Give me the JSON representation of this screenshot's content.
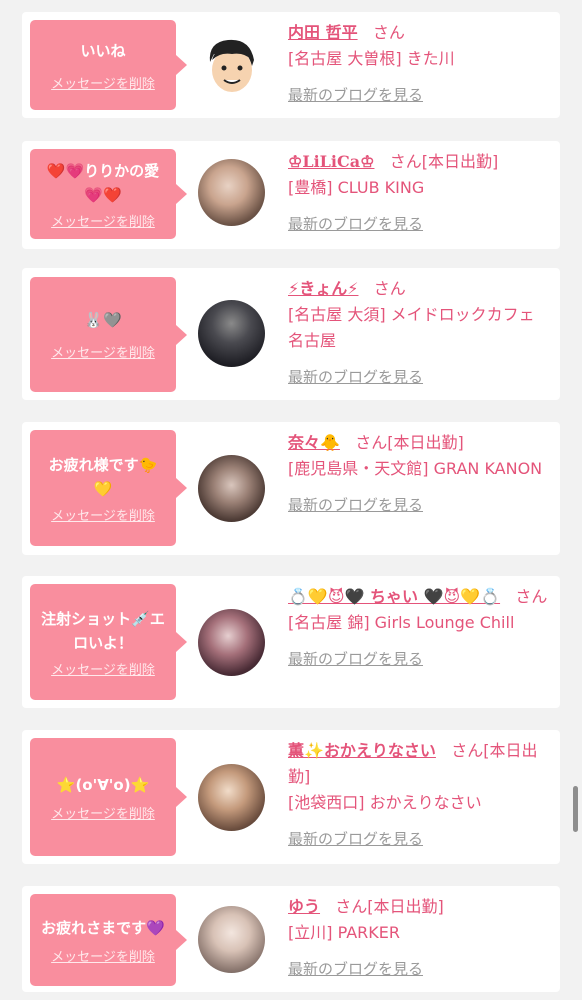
{
  "entries": [
    {
      "message": "いいね",
      "delete_label": "メッセージを削除",
      "name": "内田 哲平",
      "suffix": "さん",
      "shop": "[名古屋 大曽根] きた川",
      "blog_label": "最新のブログを見る",
      "avatar": "cartoon-face"
    },
    {
      "message": "❤️💗りりかの愛💗❤️",
      "delete_label": "メッセージを削除",
      "name": "♔LiLiCa♔",
      "suffix": "さん[本日出勤]",
      "shop": "[豊橋] CLUB KING",
      "blog_label": "最新のブログを見る",
      "avatar": "photo"
    },
    {
      "message": "🐰🩶",
      "delete_label": "メッセージを削除",
      "name": "⚡きょん⚡",
      "suffix": "さん",
      "shop": "[名古屋 大須] メイドロックカフェ名古屋",
      "blog_label": "最新のブログを見る",
      "avatar": "photo"
    },
    {
      "message": "お疲れ様です🐤💛",
      "delete_label": "メッセージを削除",
      "name": "奈々🐥",
      "suffix": "さん[本日出勤]",
      "shop": "[鹿児島県・天文館] GRAN KANON",
      "blog_label": "最新のブログを見る",
      "avatar": "photo"
    },
    {
      "message": "注射ショット💉エロいよ！",
      "delete_label": "メッセージを削除",
      "name": "💍💛😈🖤 ちゃい 🖤😈💛💍",
      "suffix": "さん",
      "shop": "[名古屋 錦] Girls Lounge Chill",
      "blog_label": "最新のブログを見る",
      "avatar": "photo"
    },
    {
      "message": "⭐(o'∀'o)⭐",
      "delete_label": "メッセージを削除",
      "name": "薫✨おかえりなさい",
      "suffix": "さん[本日出勤]",
      "shop": "[池袋西口] おかえりなさい",
      "blog_label": "最新のブログを見る",
      "avatar": "photo"
    },
    {
      "message": "お疲れさまです💜",
      "delete_label": "メッセージを削除",
      "name": "ゆう",
      "suffix": "さん[本日出勤]",
      "shop": "[立川] PARKER",
      "blog_label": "最新のブログを見る",
      "avatar": "photo"
    }
  ],
  "colors": {
    "bubble": "#f98e9e",
    "accent": "#e4547a",
    "link_gray": "#9a9a9a",
    "background": "#f2f2f2"
  }
}
